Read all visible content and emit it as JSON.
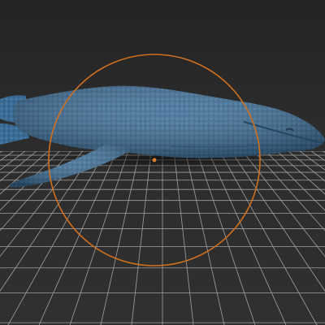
{
  "viewport": {
    "kind": "3d-sculpt-viewport",
    "background_color": "#2a2a2a",
    "grid_color": "#c8c8c8",
    "model": {
      "name": "whale-model",
      "color": "#3d6e97"
    },
    "gizmo": {
      "name": "rotate-gizmo-ring",
      "color": "#d0701e"
    },
    "pivot": {
      "name": "pivot-point",
      "color": "#e0802a"
    }
  }
}
